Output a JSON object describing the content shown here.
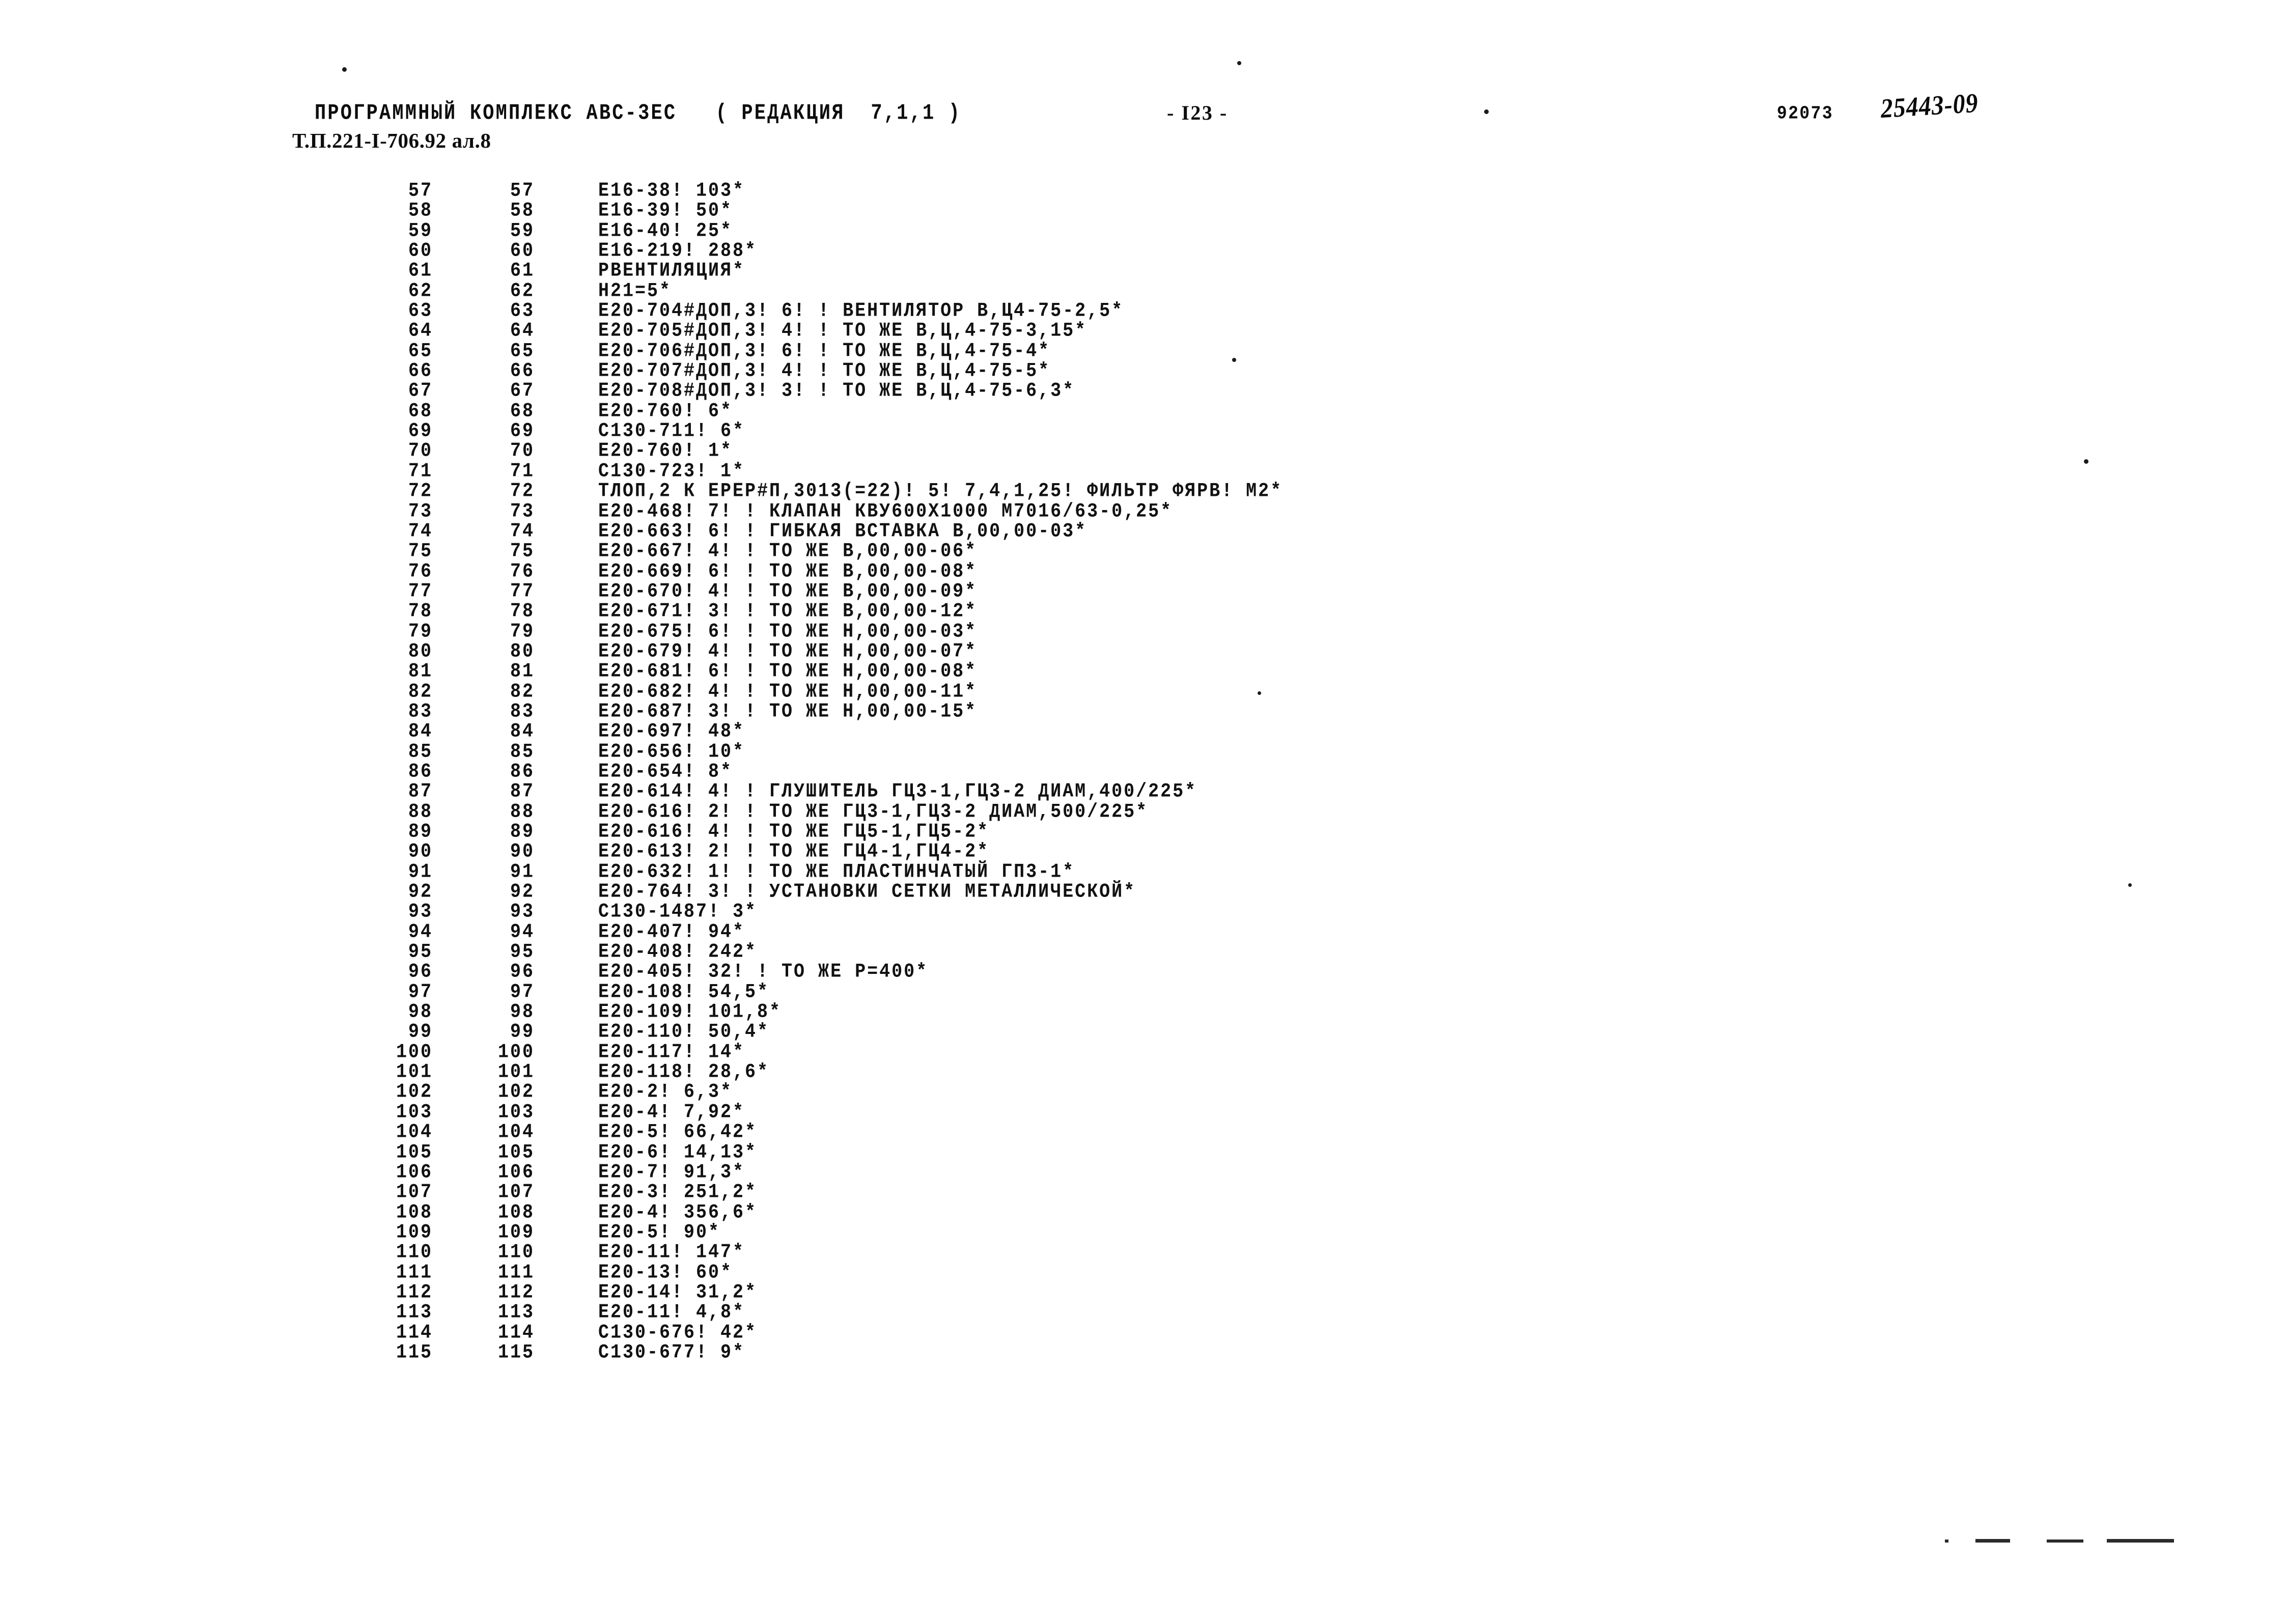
{
  "header": {
    "title": "ПРОГРАММНЫЙ КОМПЛЕКС АВС-3ЕС   ( РЕДАКЦИЯ  7,1,1 )",
    "subtitle": "Т.П.221-I-706.92 ал.8",
    "page_label": "- I23 -",
    "job_code": "92073",
    "handwritten_code": "25443-09"
  },
  "listing": {
    "columns": [
      "seq",
      "num",
      "text"
    ],
    "rows": [
      {
        "seq": "57",
        "num": "57",
        "text": "E16-38! 103*"
      },
      {
        "seq": "58",
        "num": "58",
        "text": "E16-39! 50*"
      },
      {
        "seq": "59",
        "num": "59",
        "text": "E16-40! 25*"
      },
      {
        "seq": "60",
        "num": "60",
        "text": "E16-219! 288*"
      },
      {
        "seq": "61",
        "num": "61",
        "text": "РВЕНТИЛЯЦИЯ*"
      },
      {
        "seq": "62",
        "num": "62",
        "text": "Н21=5*"
      },
      {
        "seq": "63",
        "num": "63",
        "text": "E20-704#ДОП,3! 6! ! ВЕНТИЛЯТОР В,Ц4-75-2,5*"
      },
      {
        "seq": "64",
        "num": "64",
        "text": "E20-705#ДОП,3! 4! ! ТО ЖЕ В,Ц,4-75-3,15*"
      },
      {
        "seq": "65",
        "num": "65",
        "text": "E20-706#ДОП,3! 6! ! ТО ЖЕ В,Ц,4-75-4*"
      },
      {
        "seq": "66",
        "num": "66",
        "text": "E20-707#ДОП,3! 4! ! ТО ЖЕ В,Ц,4-75-5*"
      },
      {
        "seq": "67",
        "num": "67",
        "text": "E20-708#ДОП,3! 3! ! ТО ЖЕ В,Ц,4-75-6,3*"
      },
      {
        "seq": "68",
        "num": "68",
        "text": "E20-760! 6*"
      },
      {
        "seq": "69",
        "num": "69",
        "text": "C130-711! 6*"
      },
      {
        "seq": "70",
        "num": "70",
        "text": "E20-760! 1*"
      },
      {
        "seq": "71",
        "num": "71",
        "text": "C130-723! 1*"
      },
      {
        "seq": "72",
        "num": "72",
        "text": "ТЛОП,2 К ЕРЕР#П,3013(=22)! 5! 7,4,1,25! ФИЛЬТР ФЯРВ! М2*"
      },
      {
        "seq": "73",
        "num": "73",
        "text": "E20-468! 7! ! КЛАПАН КВУ600Х1000 М7016/63-0,25*"
      },
      {
        "seq": "74",
        "num": "74",
        "text": "E20-663! 6! ! ГИБКАЯ ВСТАВКА В,00,00-03*"
      },
      {
        "seq": "75",
        "num": "75",
        "text": "E20-667! 4! ! ТО ЖЕ В,00,00-06*"
      },
      {
        "seq": "76",
        "num": "76",
        "text": "E20-669! 6! ! ТО ЖЕ В,00,00-08*"
      },
      {
        "seq": "77",
        "num": "77",
        "text": "E20-670! 4! ! ТО ЖЕ В,00,00-09*"
      },
      {
        "seq": "78",
        "num": "78",
        "text": "E20-671! 3! ! ТО ЖЕ В,00,00-12*"
      },
      {
        "seq": "79",
        "num": "79",
        "text": "E20-675! 6! ! ТО ЖЕ Н,00,00-03*"
      },
      {
        "seq": "80",
        "num": "80",
        "text": "E20-679! 4! ! ТО ЖЕ Н,00,00-07*"
      },
      {
        "seq": "81",
        "num": "81",
        "text": "E20-681! 6! ! ТО ЖЕ Н,00,00-08*"
      },
      {
        "seq": "82",
        "num": "82",
        "text": "E20-682! 4! ! ТО ЖЕ Н,00,00-11*"
      },
      {
        "seq": "83",
        "num": "83",
        "text": "E20-687! 3! ! ТО ЖЕ Н,00,00-15*"
      },
      {
        "seq": "84",
        "num": "84",
        "text": "E20-697! 48*"
      },
      {
        "seq": "85",
        "num": "85",
        "text": "E20-656! 10*"
      },
      {
        "seq": "86",
        "num": "86",
        "text": "E20-654! 8*"
      },
      {
        "seq": "87",
        "num": "87",
        "text": "E20-614! 4! ! ГЛУШИТЕЛЬ ГЦ3-1,ГЦ3-2 ДИАМ,400/225*"
      },
      {
        "seq": "88",
        "num": "88",
        "text": "E20-616! 2! ! ТО ЖЕ ГЦ3-1,ГЦ3-2 ДИАМ,500/225*"
      },
      {
        "seq": "89",
        "num": "89",
        "text": "E20-616! 4! ! ТО ЖЕ ГЦ5-1,ГЦ5-2*"
      },
      {
        "seq": "90",
        "num": "90",
        "text": "E20-613! 2! ! ТО ЖЕ ГЦ4-1,ГЦ4-2*"
      },
      {
        "seq": "91",
        "num": "91",
        "text": "E20-632! 1! ! ТО ЖЕ ПЛАСТИНЧАТЫЙ ГП3-1*"
      },
      {
        "seq": "92",
        "num": "92",
        "text": "E20-764! 3! ! УСТАНОВКИ СЕТКИ МЕТАЛЛИЧЕСКОЙ*"
      },
      {
        "seq": "93",
        "num": "93",
        "text": "C130-1487! 3*"
      },
      {
        "seq": "94",
        "num": "94",
        "text": "E20-407! 94*"
      },
      {
        "seq": "95",
        "num": "95",
        "text": "E20-408! 242*"
      },
      {
        "seq": "96",
        "num": "96",
        "text": "E20-405! 32! ! ТО ЖЕ Р=400*"
      },
      {
        "seq": "97",
        "num": "97",
        "text": "E20-108! 54,5*"
      },
      {
        "seq": "98",
        "num": "98",
        "text": "E20-109! 101,8*"
      },
      {
        "seq": "99",
        "num": "99",
        "text": "E20-110! 50,4*"
      },
      {
        "seq": "100",
        "num": "100",
        "text": "E20-117! 14*"
      },
      {
        "seq": "101",
        "num": "101",
        "text": "E20-118! 28,6*"
      },
      {
        "seq": "102",
        "num": "102",
        "text": "E20-2! 6,3*"
      },
      {
        "seq": "103",
        "num": "103",
        "text": "E20-4! 7,92*"
      },
      {
        "seq": "104",
        "num": "104",
        "text": "E20-5! 66,42*"
      },
      {
        "seq": "105",
        "num": "105",
        "text": "E20-6! 14,13*"
      },
      {
        "seq": "106",
        "num": "106",
        "text": "E20-7! 91,3*"
      },
      {
        "seq": "107",
        "num": "107",
        "text": "E20-3! 251,2*"
      },
      {
        "seq": "108",
        "num": "108",
        "text": "E20-4! 356,6*"
      },
      {
        "seq": "109",
        "num": "109",
        "text": "E20-5! 90*"
      },
      {
        "seq": "110",
        "num": "110",
        "text": "E20-11! 147*"
      },
      {
        "seq": "111",
        "num": "111",
        "text": "E20-13! 60*"
      },
      {
        "seq": "112",
        "num": "112",
        "text": "E20-14! 31,2*"
      },
      {
        "seq": "113",
        "num": "113",
        "text": "E20-11! 4,8*"
      },
      {
        "seq": "114",
        "num": "114",
        "text": "C130-676! 42*"
      },
      {
        "seq": "115",
        "num": "115",
        "text": "C130-677! 9*"
      }
    ]
  }
}
